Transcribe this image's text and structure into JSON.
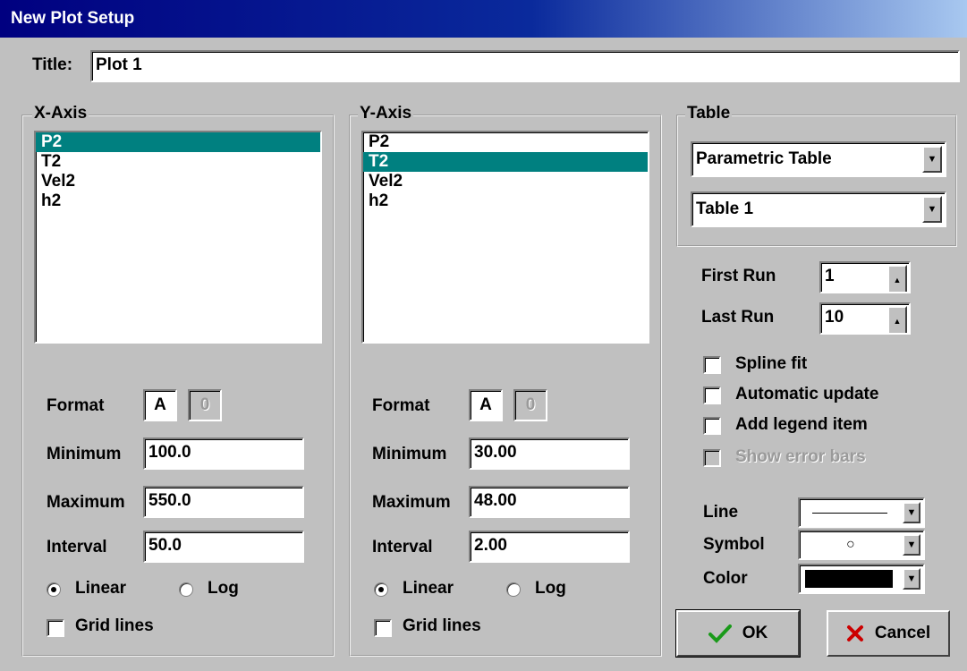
{
  "window": {
    "title": "New Plot Setup"
  },
  "plot_title": {
    "label": "Title:",
    "value": "Plot 1"
  },
  "x_axis": {
    "legend": "X-Axis",
    "items": [
      "P2",
      "T2",
      "Vel2",
      "h2"
    ],
    "selected_index": 0,
    "format_label": "Format",
    "format_type": "A",
    "format_digits": "0",
    "minimum_label": "Minimum",
    "minimum": "100.0",
    "maximum_label": "Maximum",
    "maximum": "550.0",
    "interval_label": "Interval",
    "interval": "50.0",
    "linear_label": "Linear",
    "log_label": "Log",
    "scale": "Linear",
    "grid_label": "Grid lines",
    "grid_checked": false
  },
  "y_axis": {
    "legend": "Y-Axis",
    "items": [
      "P2",
      "T2",
      "Vel2",
      "h2"
    ],
    "selected_index": 1,
    "format_label": "Format",
    "format_type": "A",
    "format_digits": "0",
    "minimum_label": "Minimum",
    "minimum": "30.00",
    "maximum_label": "Maximum",
    "maximum": "48.00",
    "interval_label": "Interval",
    "interval": "2.00",
    "linear_label": "Linear",
    "log_label": "Log",
    "scale": "Linear",
    "grid_label": "Grid lines",
    "grid_checked": false
  },
  "table": {
    "legend": "Table",
    "table_type": "Parametric Table",
    "table_name": "Table 1"
  },
  "runs": {
    "first_label": "First Run",
    "first_value": "1",
    "last_label": "Last Run",
    "last_value": "10"
  },
  "options": {
    "spline_fit": "Spline fit",
    "automatic_update": "Automatic update",
    "add_legend_item": "Add legend item",
    "show_error_bars": "Show error bars"
  },
  "style": {
    "line_label": "Line",
    "symbol_label": "Symbol",
    "symbol_value": "○",
    "color_label": "Color",
    "color_value": "#000000"
  },
  "buttons": {
    "ok": "OK",
    "cancel": "Cancel"
  },
  "colors": {
    "selection": "#008080",
    "face": "#c0c0c0",
    "title_bar": "#000080",
    "ok_check": "#1a9a1a",
    "cancel_x": "#cc0000"
  }
}
